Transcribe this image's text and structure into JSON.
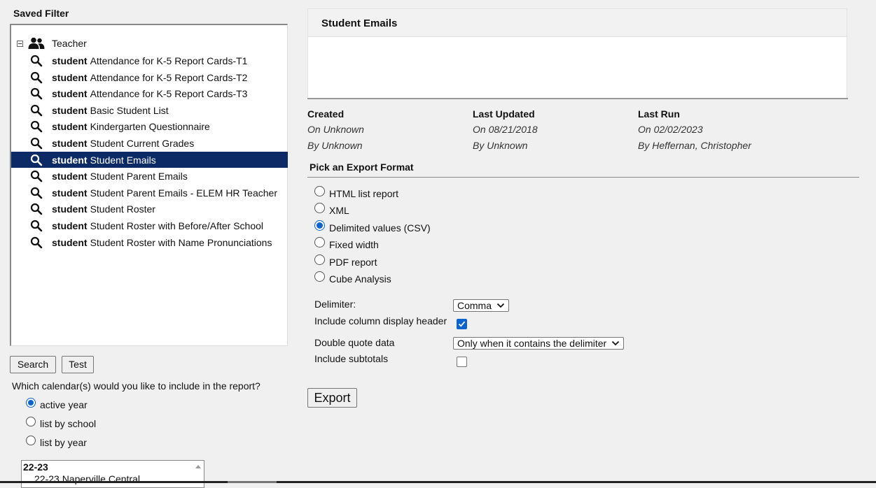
{
  "left_panel": {
    "saved_filter_title": "Saved Filter",
    "tree": {
      "root_label": "Teacher",
      "items": [
        {
          "prefix": "student",
          "label": "Attendance for K-5 Report Cards-T1"
        },
        {
          "prefix": "student",
          "label": "Attendance for K-5 Report Cards-T2"
        },
        {
          "prefix": "student",
          "label": "Attendance for K-5 Report Cards-T3"
        },
        {
          "prefix": "student",
          "label": "Basic Student List"
        },
        {
          "prefix": "student",
          "label": "Kindergarten Questionnaire"
        },
        {
          "prefix": "student",
          "label": "Student Current Grades"
        },
        {
          "prefix": "student",
          "label": "Student Emails"
        },
        {
          "prefix": "student",
          "label": "Student Parent Emails"
        },
        {
          "prefix": "student",
          "label": "Student Parent Emails - ELEM HR Teacher"
        },
        {
          "prefix": "student",
          "label": "Student Roster"
        },
        {
          "prefix": "student",
          "label": "Student Roster with Before/After School"
        },
        {
          "prefix": "student",
          "label": "Student Roster with Name Pronunciations"
        }
      ],
      "selected_index": 6
    },
    "search_label": "Search",
    "test_label": "Test",
    "calendar_question": "Which calendar(s) would you like to include in the report?",
    "calendar_options": [
      {
        "label": "active year",
        "selected": true
      },
      {
        "label": "list by school",
        "selected": false
      },
      {
        "label": "list by year",
        "selected": false
      }
    ],
    "calendar_list": {
      "group": "22-23",
      "option": "22-23 Naperville Central"
    }
  },
  "report": {
    "title": "Student Emails",
    "created_label": "Created",
    "created_on": "On Unknown",
    "created_by": "By Unknown",
    "updated_label": "Last Updated",
    "updated_on": "On 08/21/2018",
    "updated_by": "By Unknown",
    "lastrun_label": "Last Run",
    "lastrun_on": "On 02/02/2023",
    "lastrun_by": "By Heffernan, Christopher"
  },
  "export": {
    "pick_title": "Pick an Export Format",
    "formats": [
      {
        "label": "HTML list report",
        "selected": false
      },
      {
        "label": "XML",
        "selected": false
      },
      {
        "label": "Delimited values (CSV)",
        "selected": true
      },
      {
        "label": "Fixed width",
        "selected": false
      },
      {
        "label": "PDF report",
        "selected": false
      },
      {
        "label": "Cube Analysis",
        "selected": false
      }
    ],
    "delimiter_label": "Delimiter:",
    "delimiter_value": "Comma",
    "header_label": "Include column display header",
    "header_checked": true,
    "quote_label": "Double quote data",
    "quote_value": "Only when it contains the delimiter",
    "subtotals_label": "Include subtotals",
    "subtotals_checked": false,
    "export_button": "Export"
  },
  "colors": {
    "selection": "#0b2a66",
    "accent": "#0b63ce",
    "background": "#f0f0f0"
  }
}
